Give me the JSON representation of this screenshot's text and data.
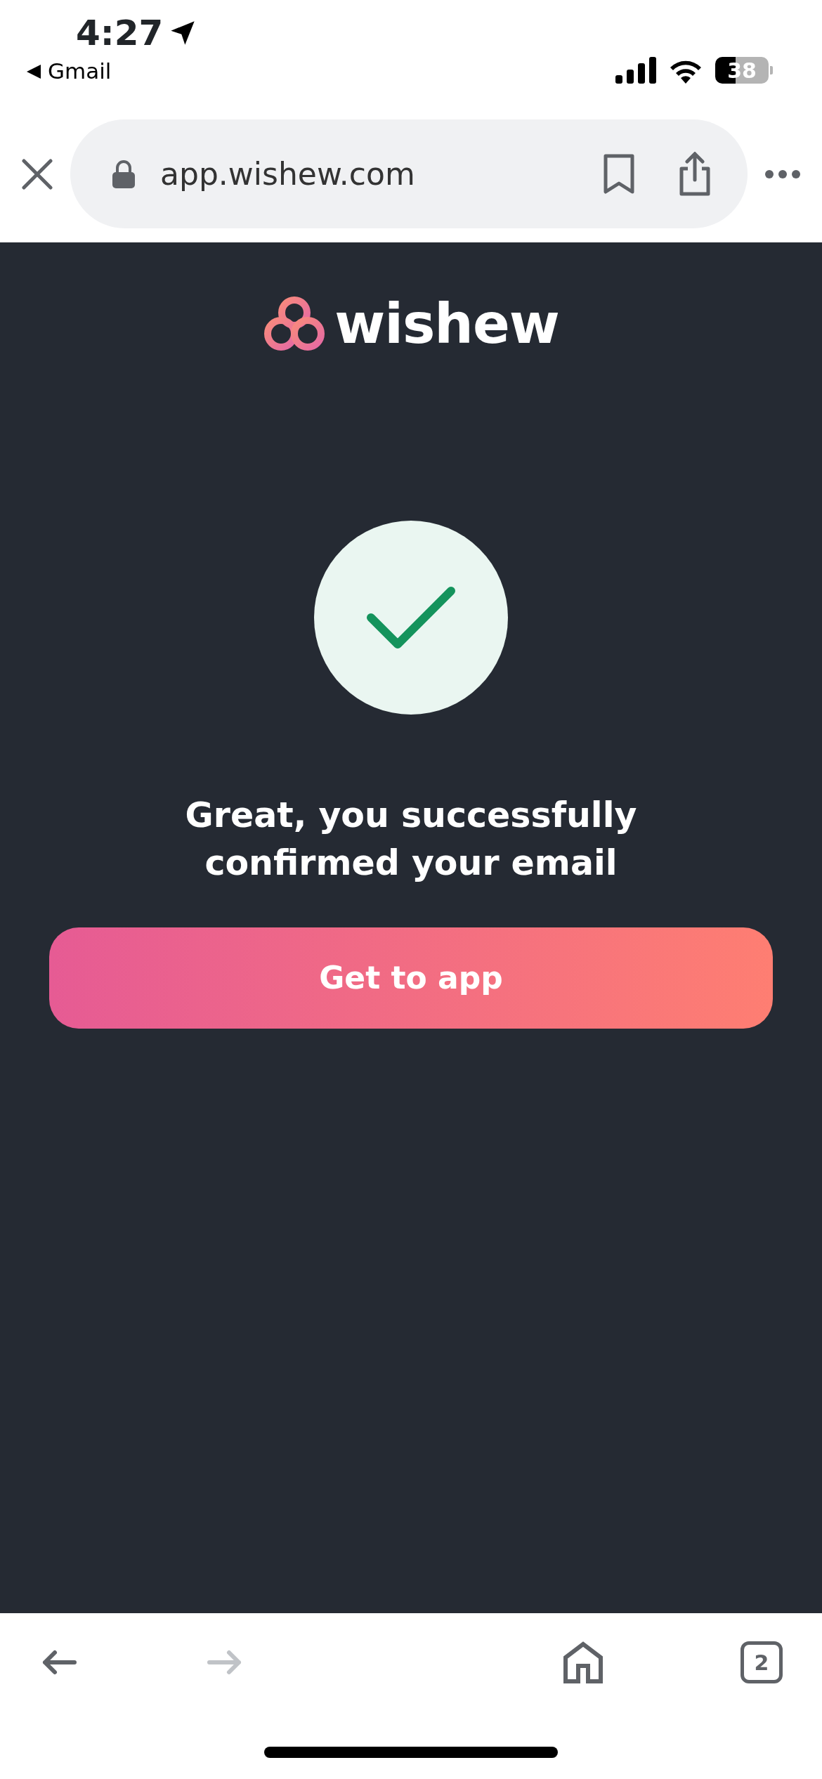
{
  "status_bar": {
    "time": "4:27",
    "back_app": "Gmail",
    "battery": "38"
  },
  "browser_bar": {
    "url": "app.wishew.com"
  },
  "page": {
    "logo_text": "wishew",
    "headline": "Great, you successfully confirmed your email",
    "button": "Get to app"
  },
  "bottom_bar": {
    "buttons": [
      {
        "kind": "back",
        "disabled": false
      },
      {
        "kind": "forward",
        "disabled": true
      },
      {
        "kind": "home",
        "disabled": false
      }
    ],
    "tab_count": "2"
  }
}
